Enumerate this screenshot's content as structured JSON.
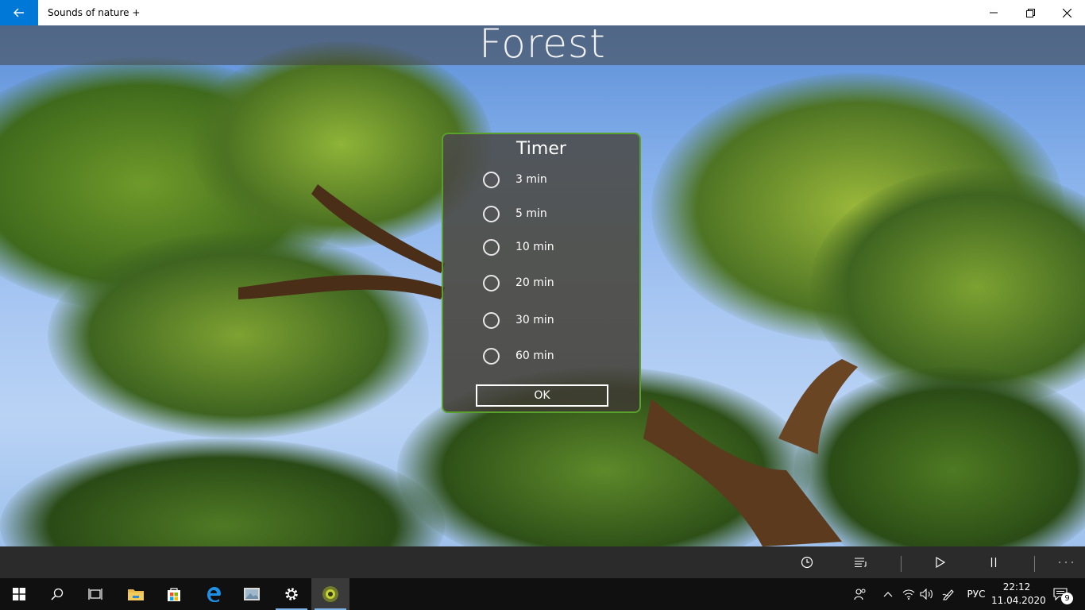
{
  "window": {
    "title": "Sounds of nature +"
  },
  "scene": {
    "title": "Forest"
  },
  "dialog": {
    "title": "Timer",
    "options": [
      "3 min",
      "5 min",
      "10 min",
      "20 min",
      "30 min",
      "60 min"
    ],
    "ok_label": "OK"
  },
  "command_bar": {
    "icons": [
      "clock-icon",
      "playlist-icon",
      "play-icon",
      "pause-icon",
      "more-icon"
    ]
  },
  "taskbar": {
    "language": "РУС",
    "time": "22:12",
    "date": "11.04.2020",
    "notification_count": "9"
  },
  "colors": {
    "accent": "#0078d7",
    "dialog_border": "#5aa02c"
  }
}
